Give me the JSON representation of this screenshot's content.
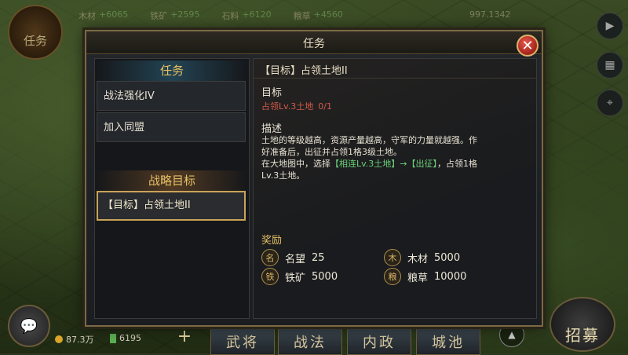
{
  "background": {
    "resources": [
      {
        "name": "木材",
        "value": "+6065"
      },
      {
        "name": "铁矿",
        "value": "+2595"
      },
      {
        "name": "石料",
        "value": "+6120"
      },
      {
        "name": "粮草",
        "value": "+4560"
      }
    ],
    "coords": "997.1342",
    "task_button_label": "任务",
    "gold": "87.3万",
    "food": "6195",
    "tabs": [
      "武将",
      "战法",
      "内政",
      "城池"
    ],
    "recruit_label": "招募"
  },
  "modal": {
    "title": "任务",
    "close_symbol": "✕",
    "left": {
      "section_tasks": "任务",
      "tasks": [
        "战法强化IV",
        "加入同盟"
      ],
      "section_strategy": "战略目标",
      "strategy_goal": "【目标】占领土地II"
    },
    "right": {
      "title": "【目标】占领土地II",
      "goal_label": "目标",
      "goal_text": "占领Lv.3土地",
      "goal_progress": "0/1",
      "desc_label": "描述",
      "desc_line1": "土地的等级越高，资源产量越高，守军的力量就越强。作好准备后，出征并占领1格3级土地。",
      "desc_line2_prefix": "在大地图中，选择",
      "desc_line2_green": "【相连Lv.3土地】→【出征】",
      "desc_line2_suffix": "，占领1格Lv.3土地。",
      "reward_label": "奖励",
      "rewards": [
        {
          "icon": "名",
          "name": "名望",
          "amount": "25"
        },
        {
          "icon": "木",
          "name": "木材",
          "amount": "5000"
        },
        {
          "icon": "铁",
          "name": "铁矿",
          "amount": "5000"
        },
        {
          "icon": "粮",
          "name": "粮草",
          "amount": "10000"
        }
      ]
    }
  }
}
